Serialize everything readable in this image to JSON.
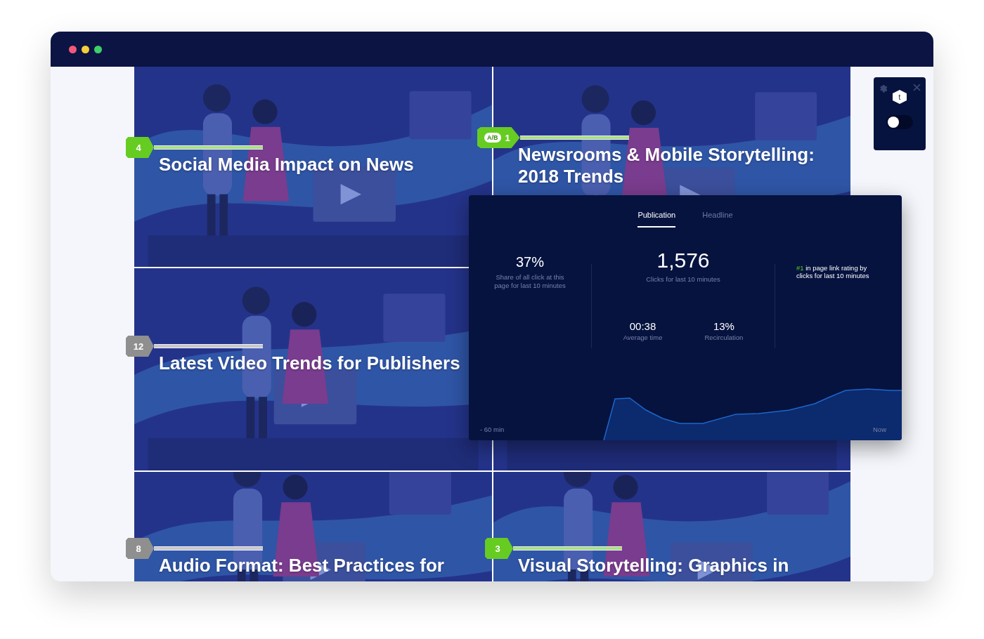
{
  "tiles": [
    {
      "title": "Social Media Impact on News",
      "badge": {
        "number": "4",
        "color": "#66cc22"
      }
    },
    {
      "title": "Newsrooms & Mobile Storytelling: 2018 Trends",
      "badge": {
        "number": "1",
        "color": "#66cc22",
        "ab": "A/B"
      }
    },
    {
      "title": "Latest Video Trends for Publishers",
      "badge": {
        "number": "12",
        "color": "#8f8f8f"
      }
    },
    {
      "kind": "picture"
    },
    {
      "title": "Audio Format: Best Practices for",
      "badge": {
        "number": "8",
        "color": "#8f8f8f"
      }
    },
    {
      "title": "Visual Storytelling: Graphics in",
      "badge": {
        "number": "3",
        "color": "#66cc22"
      }
    }
  ],
  "panel": {
    "tabs": [
      {
        "label": "Publication",
        "selected": true
      },
      {
        "label": "Headline",
        "selected": false
      }
    ],
    "share": {
      "value": "37%",
      "caption": "Share of all click at this page for last 10 minutes"
    },
    "clicks": {
      "value": "1,576",
      "caption": "Clicks for last 10 minutes"
    },
    "rank": {
      "mark": "#1",
      "text": "in page link rating by clicks for last 10 minutes"
    },
    "metrics": [
      {
        "value": "00:38",
        "caption": "Average time"
      },
      {
        "value": "13%",
        "caption": "Recirculation"
      }
    ],
    "axis": {
      "start": "- 60 min",
      "end": "Now"
    }
  },
  "widget": {
    "logo": "t",
    "toggle": {
      "on": false
    }
  }
}
